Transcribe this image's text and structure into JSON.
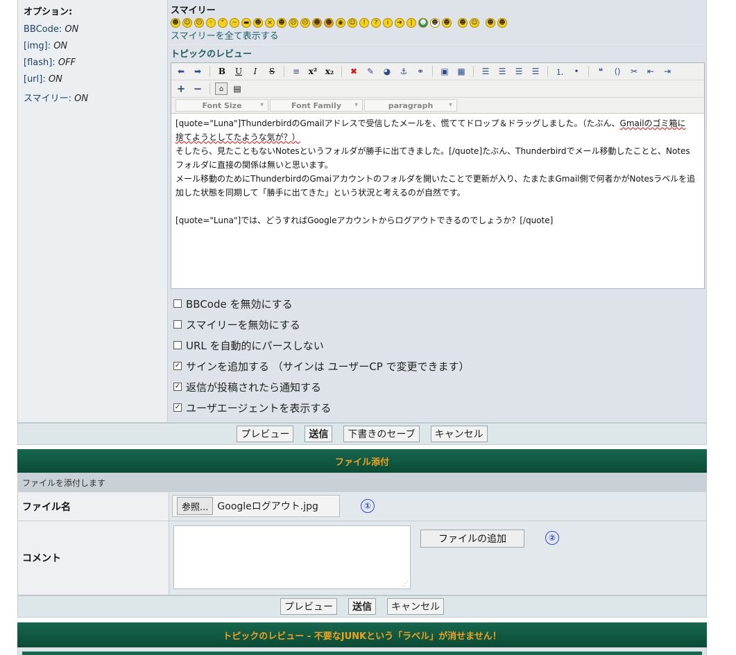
{
  "options": {
    "title": "オプション:",
    "items": [
      {
        "label": "BBCode:",
        "value": "ON"
      },
      {
        "label": "[img]:",
        "value": "ON"
      },
      {
        "label": "[flash]:",
        "value": "OFF"
      },
      {
        "label": "[url]:",
        "value": "ON"
      },
      {
        "label": "スマイリー:",
        "value": "ON"
      }
    ]
  },
  "smilies": {
    "title": "スマイリー",
    "show_all": "スマイリーを全て表示する",
    "icons": [
      ":D",
      ":)",
      ":(",
      ":o",
      ":shock:",
      ":?",
      "8)",
      ":lol:",
      ":x",
      ":P",
      ":oops:",
      ":cry:",
      ":evil:",
      ":twisted:",
      ":roll:",
      ":wink:",
      ":!:",
      ":?:",
      ":idea:",
      ":arrow:",
      ":|",
      ":mrgreen:",
      ":geek:",
      ":ugeek:",
      ":smile2:",
      ":wave:",
      ":ok:",
      ":think:"
    ]
  },
  "editor": {
    "title": "トピックのレビュー",
    "font_size": "Font Size",
    "font_family": "Font Family",
    "paragraph": "paragraph",
    "toolbar_icons": [
      "undo-arrow",
      "redo-arrow",
      "bold",
      "underline",
      "italic",
      "strike",
      "hr",
      "superscript",
      "subscript",
      "remove",
      "spell",
      "color",
      "anchor",
      "unlink",
      "image",
      "table",
      "align-left",
      "align-center",
      "align-right",
      "justify",
      "ordered-list",
      "unordered-list",
      "quote",
      "code",
      "clean",
      "outdent",
      "indent",
      "zoom-in",
      "zoom-out",
      "source",
      "media"
    ],
    "text": {
      "line1a": "[quote=\"Luna\"]ThunderbirdのGmailアドレスで受信したメールを、慌ててドロップ＆ドラッグしました。（たぶん、",
      "line1b": "Gmailのゴミ箱に",
      "line2": "捨てようとしてたような気が？）",
      "line3": "そしたら、見たこともないNotesというフォルダが勝手に出てきました。[/quote]たぶん、Thunderbirdでメール移動したことと、Notes",
      "line4": "フォルダに直接の関係は無いと思います。",
      "line5": "メール移動のためにThunderbirdのGmaiアカウントのフォルダを開いたことで更新が入り、たまたまGmail側で何者かがNotesラベルを追",
      "line6": "加した状態を同期して「勝手に出てきた」という状況と考えるのが自然です。",
      "line7": "[quote=\"Luna\"]では、どうすればGoogleアカウントからログアウトできるのでしょうか？[/quote]"
    }
  },
  "checkboxes": [
    {
      "label": "BBCode を無効にする",
      "checked": false
    },
    {
      "label": "スマイリーを無効にする",
      "checked": false
    },
    {
      "label": "URL を自動的にパースしない",
      "checked": false
    },
    {
      "label": "サインを追加する （サインは ユーザーCP で変更できます）",
      "checked": true
    },
    {
      "label": "返信が投稿されたら通知する",
      "checked": true
    },
    {
      "label": "ユーザエージェントを表示する",
      "checked": true
    }
  ],
  "buttons": {
    "preview": "プレビュー",
    "submit": "送信",
    "save_draft": "下書きのセーブ",
    "cancel": "キャンセル"
  },
  "attach": {
    "header": "ファイル添付",
    "subheader": "ファイルを添付します",
    "filename_label": "ファイル名",
    "browse": "参照...",
    "filename_value": "Googleログアウト.jpg",
    "marker1": "①",
    "comment_label": "コメント",
    "add_file": "ファイルの追加",
    "marker2": "②"
  },
  "bottom_header": "トピックのレビュー - 不要なJUNKという「ラベル」が消せません！",
  "colors": {
    "header_green": "#0f5a40",
    "header_text": "#f4a21e",
    "marker_blue": "#3646c8"
  }
}
